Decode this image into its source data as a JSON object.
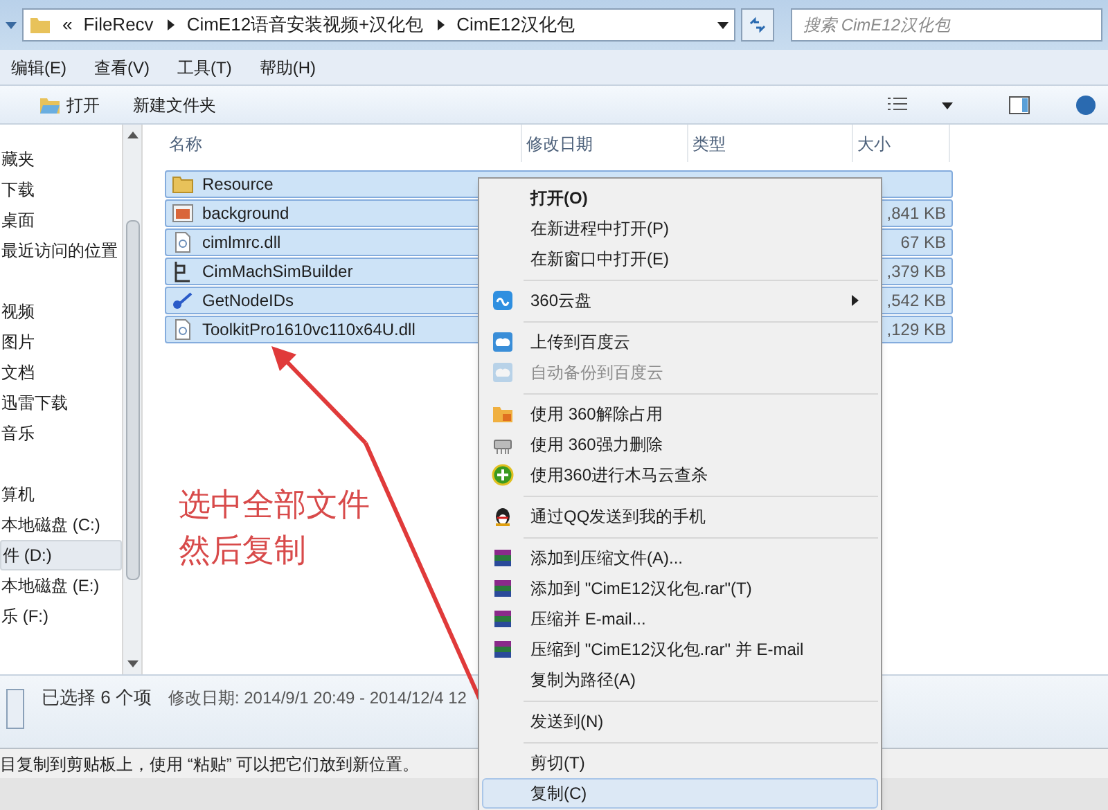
{
  "address_bar": {
    "breadcrumbs": [
      "«",
      "FileRecv",
      "CimE12语音安装视频+汉化包",
      "CimE12汉化包"
    ],
    "search": {
      "placeholder": "搜索 CimE12汉化包"
    }
  },
  "menu_bar": [
    "编辑(E)",
    "查看(V)",
    "工具(T)",
    "帮助(H)"
  ],
  "toolbar": [
    {
      "label": "打开",
      "kind": "open"
    },
    {
      "label": "新建文件夹",
      "kind": "text"
    }
  ],
  "sidebar": {
    "items": [
      {
        "label": "藏夹",
        "selected": false,
        "kind": "item"
      },
      {
        "label": "下载",
        "selected": false,
        "kind": "item"
      },
      {
        "label": "桌面",
        "selected": false,
        "kind": "item"
      },
      {
        "label": "最近访问的位置",
        "selected": false,
        "kind": "item"
      },
      {
        "label": "视频",
        "selected": false,
        "kind": "group"
      },
      {
        "label": "图片",
        "selected": false,
        "kind": "item"
      },
      {
        "label": "文档",
        "selected": false,
        "kind": "item"
      },
      {
        "label": "迅雷下载",
        "selected": false,
        "kind": "item"
      },
      {
        "label": "音乐",
        "selected": false,
        "kind": "item"
      },
      {
        "label": "算机",
        "selected": false,
        "kind": "group"
      },
      {
        "label": "本地磁盘 (C:)",
        "selected": false,
        "kind": "item"
      },
      {
        "label": "件 (D:)",
        "selected": true,
        "kind": "item"
      },
      {
        "label": "本地磁盘 (E:)",
        "selected": false,
        "kind": "item"
      },
      {
        "label": "乐 (F:)",
        "selected": false,
        "kind": "item"
      }
    ]
  },
  "columns": [
    "名称",
    "修改日期",
    "类型",
    "大小"
  ],
  "files": [
    {
      "name": "Resource",
      "kind": "folder",
      "selected": true
    },
    {
      "name": "background",
      "size": ",841 KB",
      "kind": "image",
      "selected": true
    },
    {
      "name": "cimlmrc.dll",
      "size": "67 KB",
      "kind": "dll",
      "selected": true
    },
    {
      "name": "CimMachSimBuilder",
      "size": ",379 KB",
      "kind": "app",
      "selected": true
    },
    {
      "name": "GetNodeIDs",
      "size": ",542 KB",
      "kind": "script",
      "selected": true
    },
    {
      "name": "ToolkitPro1610vc110x64U.dll",
      "size": ",129 KB",
      "kind": "dll",
      "selected": true
    }
  ],
  "details": {
    "selection": "已选择 6 个项",
    "modified": "修改日期: 2014/9/1 20:49 - 2014/12/4 12"
  },
  "status_bar": "目复制到剪贴板上，使用 “粘贴” 可以把它们放到新位置。",
  "annotation": {
    "lines": [
      "选中全部文件",
      "然后复制"
    ]
  },
  "context_menu": {
    "items": [
      {
        "kind": "item",
        "label": "打开(O)",
        "default": true,
        "disabled": false,
        "submenu": false,
        "selected": false
      },
      {
        "kind": "item",
        "label": "在新进程中打开(P)",
        "default": false,
        "disabled": false,
        "submenu": false,
        "selected": false
      },
      {
        "kind": "item",
        "label": "在新窗口中打开(E)",
        "default": false,
        "disabled": false,
        "submenu": false,
        "selected": false
      },
      {
        "kind": "separator"
      },
      {
        "kind": "item",
        "label": "360云盘",
        "default": false,
        "disabled": false,
        "submenu": true,
        "selected": false
      },
      {
        "kind": "separator"
      },
      {
        "kind": "item",
        "label": "上传到百度云",
        "default": false,
        "disabled": false,
        "submenu": false,
        "selected": false
      },
      {
        "kind": "item",
        "label": "自动备份到百度云",
        "default": false,
        "disabled": true,
        "submenu": false,
        "selected": false
      },
      {
        "kind": "separator"
      },
      {
        "kind": "item",
        "label": "使用 360解除占用",
        "default": false,
        "disabled": false,
        "submenu": false,
        "selected": false
      },
      {
        "kind": "item",
        "label": "使用 360强力删除",
        "default": false,
        "disabled": false,
        "submenu": false,
        "selected": false
      },
      {
        "kind": "item",
        "label": "使用360进行木马云查杀",
        "default": false,
        "disabled": false,
        "submenu": false,
        "selected": false
      },
      {
        "kind": "separator"
      },
      {
        "kind": "item",
        "label": "通过QQ发送到我的手机",
        "default": false,
        "disabled": false,
        "submenu": false,
        "selected": false
      },
      {
        "kind": "separator"
      },
      {
        "kind": "item",
        "label": "添加到压缩文件(A)...",
        "default": false,
        "disabled": false,
        "submenu": false,
        "selected": false
      },
      {
        "kind": "item",
        "label": "添加到 \"CimE12汉化包.rar\"(T)",
        "default": false,
        "disabled": false,
        "submenu": false,
        "selected": false
      },
      {
        "kind": "item",
        "label": "压缩并 E-mail...",
        "default": false,
        "disabled": false,
        "submenu": false,
        "selected": false
      },
      {
        "kind": "item",
        "label": "压缩到 \"CimE12汉化包.rar\" 并 E-mail",
        "default": false,
        "disabled": false,
        "submenu": false,
        "selected": false
      },
      {
        "kind": "item",
        "label": "复制为路径(A)",
        "default": false,
        "disabled": false,
        "submenu": false,
        "selected": false
      },
      {
        "kind": "separator"
      },
      {
        "kind": "item",
        "label": "发送到(N)",
        "default": false,
        "disabled": false,
        "submenu": false,
        "selected": false
      },
      {
        "kind": "separator"
      },
      {
        "kind": "item",
        "label": "剪切(T)",
        "default": false,
        "disabled": false,
        "submenu": false,
        "selected": false
      },
      {
        "kind": "item",
        "label": "复制(C)",
        "default": false,
        "disabled": false,
        "submenu": false,
        "selected": true
      }
    ]
  }
}
